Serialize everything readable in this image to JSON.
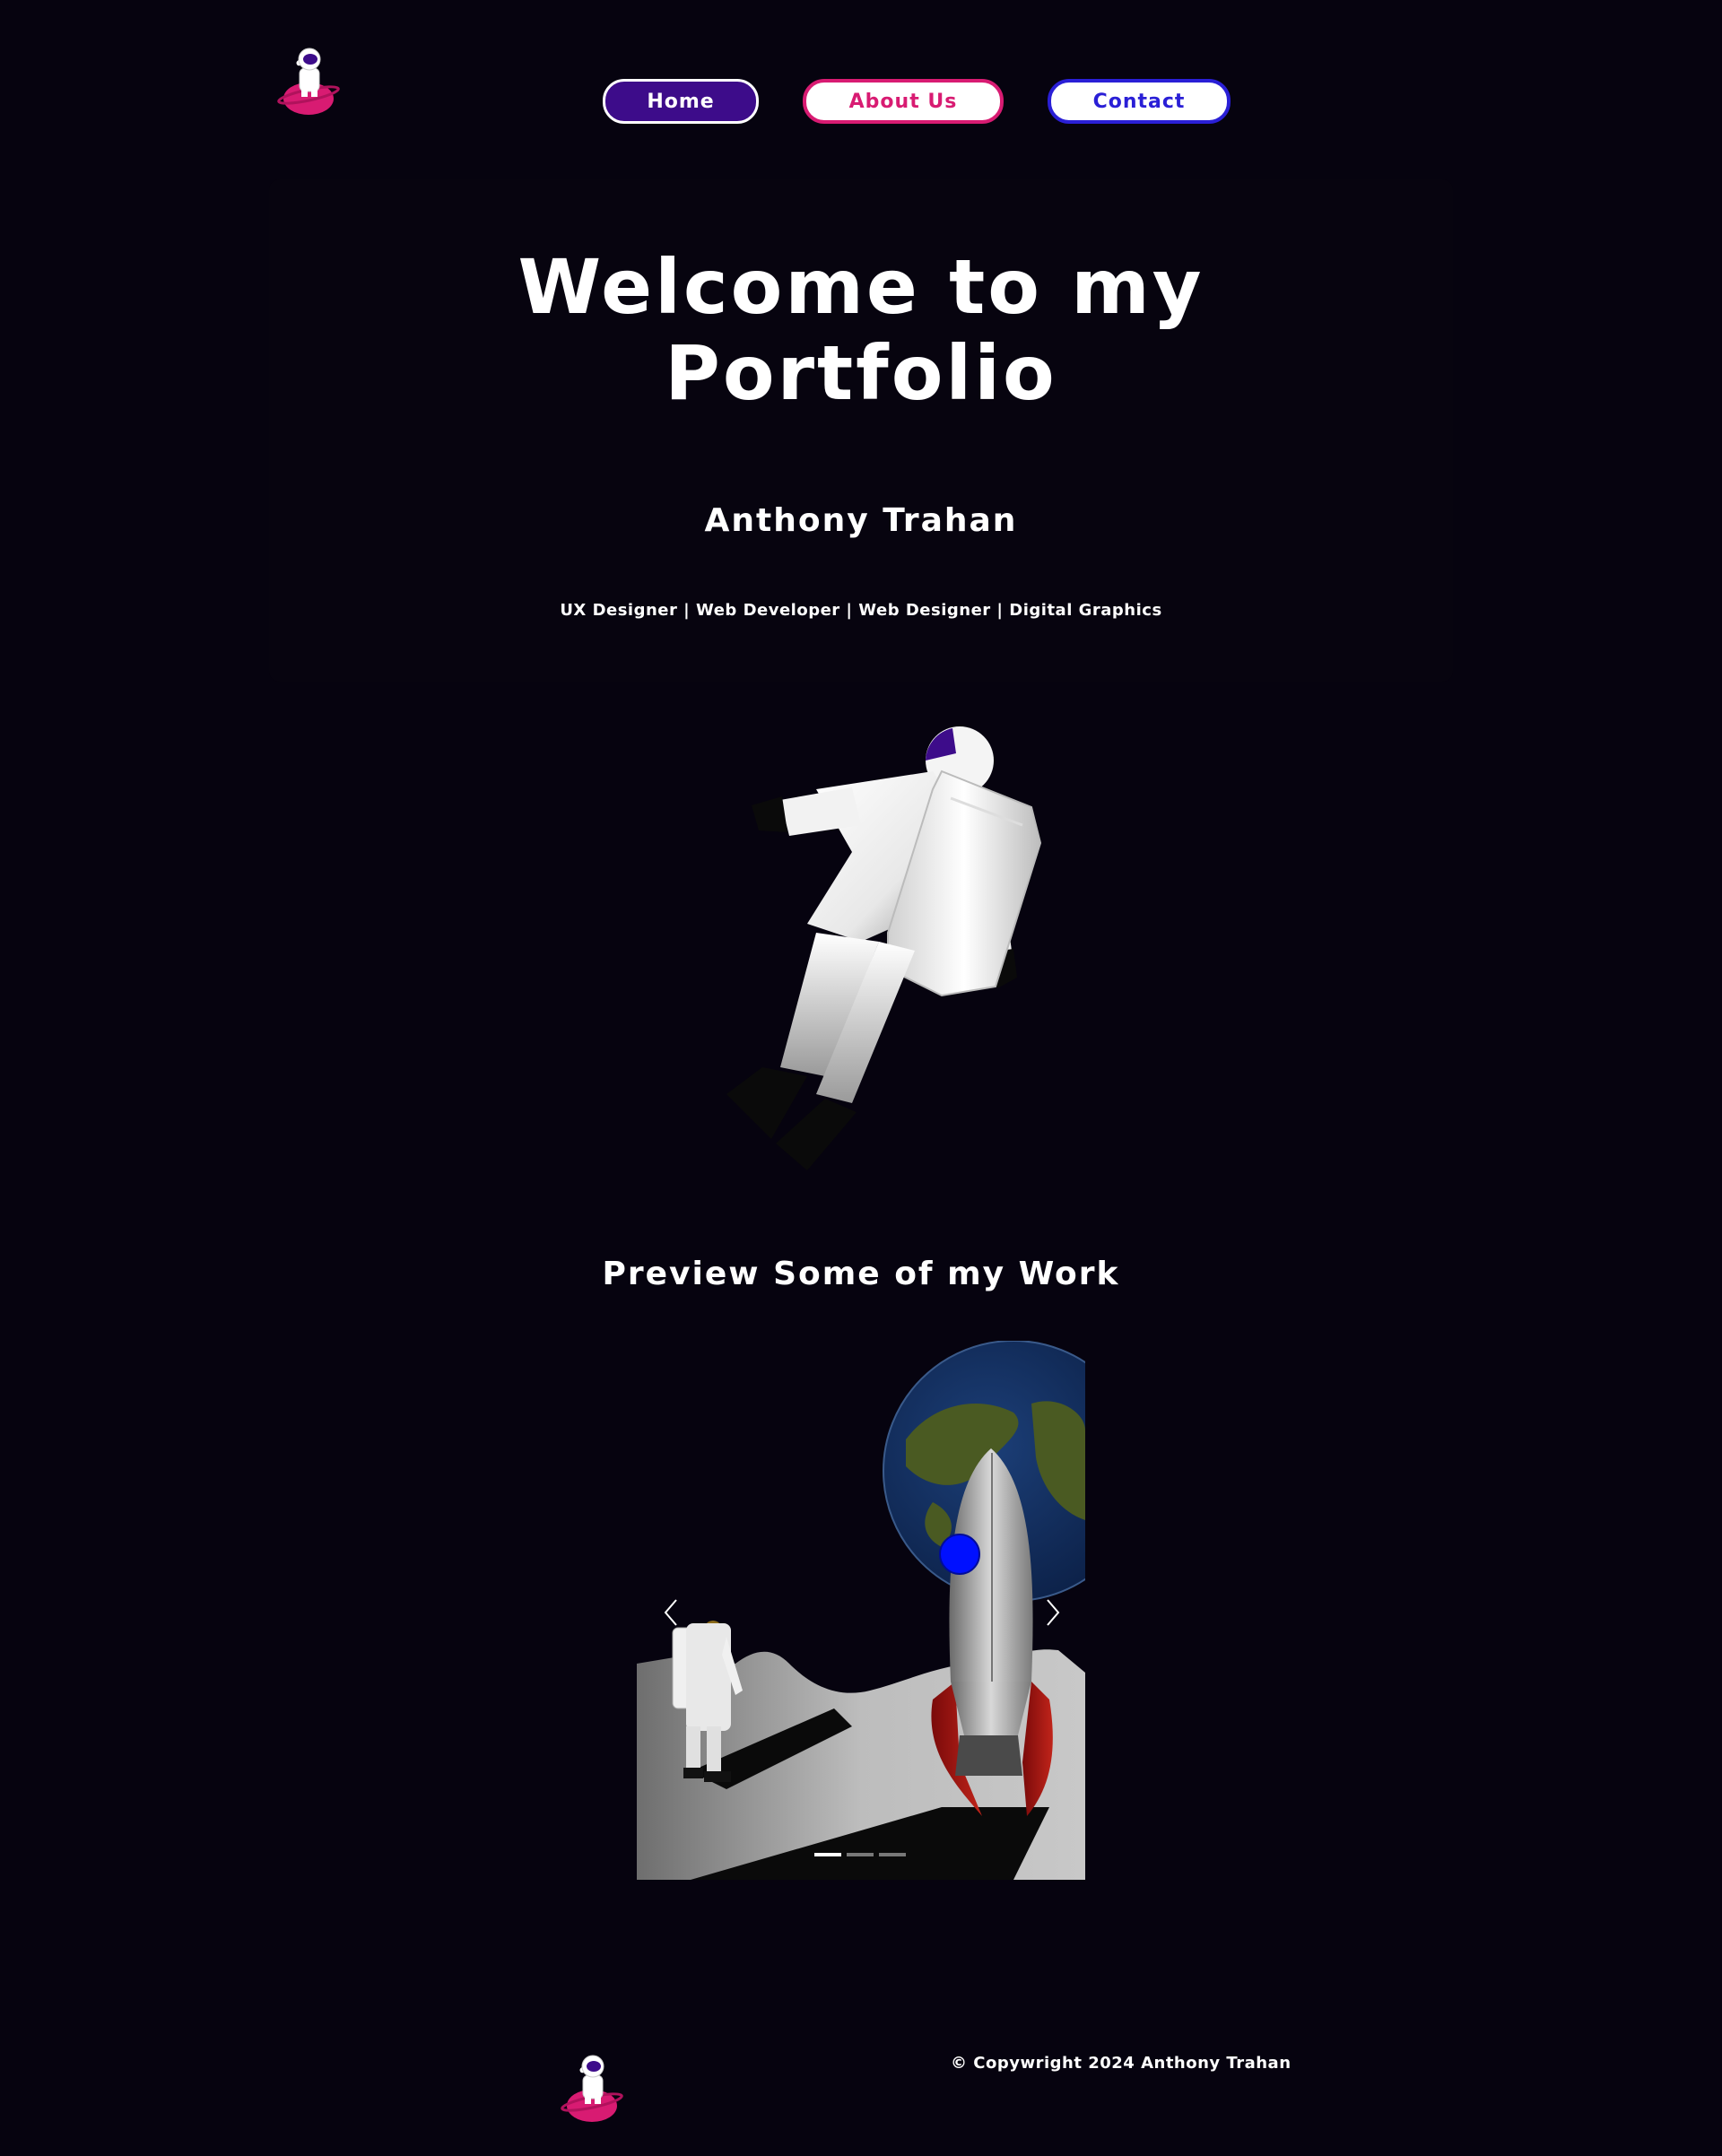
{
  "nav": {
    "home_label": "Home",
    "about_label": "About Us",
    "contact_label": "Contact"
  },
  "hero": {
    "title_line1": "Welcome to my",
    "title_line2": "Portfolio",
    "name": "Anthony Trahan",
    "roles": "UX Designer | Web Developer | Web Designer | Digital Graphics"
  },
  "preview": {
    "heading": "Preview Some of my Work",
    "slide_count": 3,
    "active_slide": 1
  },
  "footer": {
    "copyright": "© Copywright 2024 Anthony Trahan"
  },
  "colors": {
    "background": "#06030f",
    "home_bg": "#3d0c8a",
    "about_accent": "#d81b72",
    "contact_accent": "#2a1fd6"
  },
  "icons": {
    "logo": "astronaut-on-planet-icon",
    "prev": "chevron-left-icon",
    "next": "chevron-right-icon"
  }
}
